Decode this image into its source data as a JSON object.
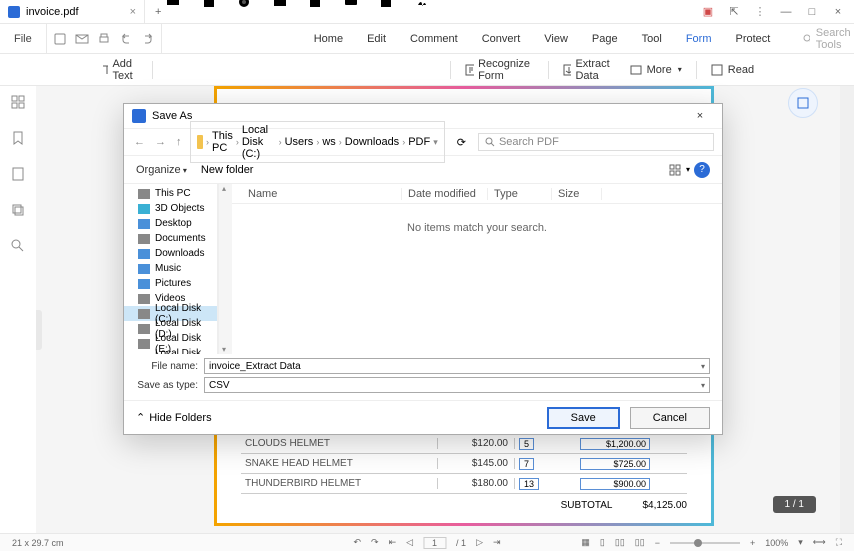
{
  "tab": {
    "title": "invoice.pdf"
  },
  "menu": {
    "file": "File",
    "items": [
      "Home",
      "Edit",
      "Comment",
      "Convert",
      "View",
      "Page",
      "Tool",
      "Form",
      "Protect"
    ],
    "active": "Form",
    "search_placeholder": "Search Tools"
  },
  "toolbar": {
    "add_text": "Add Text",
    "recognize_form": "Recognize Form",
    "extract_data": "Extract Data",
    "more": "More",
    "read": "Read"
  },
  "invoice": {
    "rows": [
      {
        "name": "CLOUDS HELMET",
        "price": "$120.00",
        "qty": "5",
        "total": "$1,200.00"
      },
      {
        "name": "SNAKE HEAD HELMET",
        "price": "$145.00",
        "qty": "7",
        "total": "$725.00"
      },
      {
        "name": "THUNDERBIRD HELMET",
        "price": "$180.00",
        "qty": "13",
        "total": "$900.00"
      }
    ],
    "subtotal_label": "SUBTOTAL",
    "subtotal": "$4,125.00"
  },
  "dialog": {
    "title": "Save As",
    "breadcrumb": [
      "This PC",
      "Local Disk (C:)",
      "Users",
      "ws",
      "Downloads",
      "PDF"
    ],
    "search_placeholder": "Search PDF",
    "organize": "Organize",
    "new_folder": "New folder",
    "tree": [
      {
        "label": "This PC",
        "icon": "ti-pc"
      },
      {
        "label": "3D Objects",
        "icon": "ti-3d"
      },
      {
        "label": "Desktop",
        "icon": "ti-desktop"
      },
      {
        "label": "Documents",
        "icon": "ti-docs"
      },
      {
        "label": "Downloads",
        "icon": "ti-down"
      },
      {
        "label": "Music",
        "icon": "ti-music"
      },
      {
        "label": "Pictures",
        "icon": "ti-pics"
      },
      {
        "label": "Videos",
        "icon": "ti-vids"
      },
      {
        "label": "Local Disk (C:)",
        "icon": "ti-disk",
        "selected": true
      },
      {
        "label": "Local Disk (D:)",
        "icon": "ti-disk"
      },
      {
        "label": "Local Disk (E:)",
        "icon": "ti-disk"
      },
      {
        "label": "Local Disk (F:)",
        "icon": "ti-disk"
      }
    ],
    "columns": {
      "name": "Name",
      "date": "Date modified",
      "type": "Type",
      "size": "Size"
    },
    "empty": "No items match your search.",
    "filename_label": "File name:",
    "filename": "invoice_Extract Data",
    "savetype_label": "Save as type:",
    "savetype": "CSV",
    "hide_folders": "Hide Folders",
    "save": "Save",
    "cancel": "Cancel"
  },
  "statusbar": {
    "dims": "21 x 29.7 cm",
    "page": "1",
    "pages": "/ 1",
    "zoom": "100%",
    "pageind": "1 / 1"
  }
}
